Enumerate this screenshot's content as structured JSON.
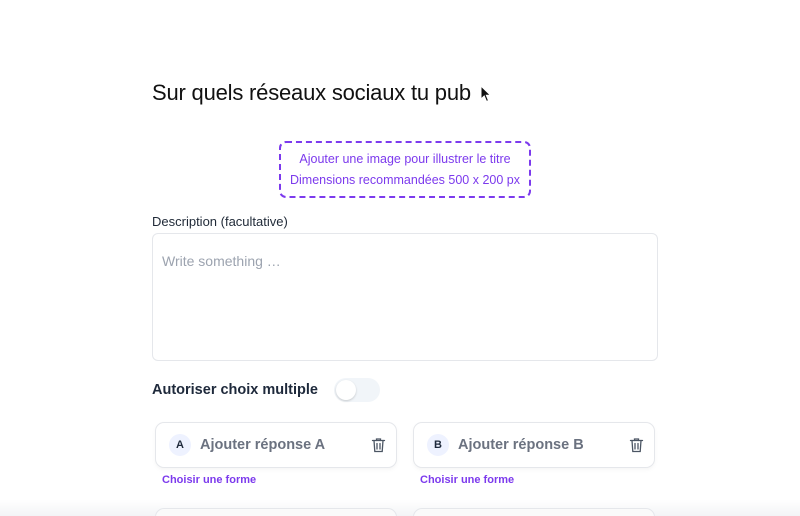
{
  "question": {
    "title": "Sur quels réseaux sociaux tu pub"
  },
  "image_upload": {
    "line1": "Ajouter une image pour illustrer le titre",
    "line2": "Dimensions recommandées 500 x 200 px"
  },
  "description": {
    "label": "Description (facultative)",
    "placeholder": "Write something …",
    "value": ""
  },
  "multiple_choice": {
    "label": "Autoriser choix multiple",
    "enabled": false
  },
  "answers": [
    {
      "letter": "A",
      "placeholder": "Ajouter réponse A",
      "shape_link": "Choisir une forme"
    },
    {
      "letter": "B",
      "placeholder": "Ajouter réponse B",
      "shape_link": "Choisir une forme"
    }
  ],
  "colors": {
    "accent": "#7c3aed",
    "text": "#1f2937",
    "muted": "#6b7280",
    "border": "#e5e7eb"
  },
  "icons": {
    "cursor": "mouse-pointer-icon",
    "delete": "trash-icon"
  }
}
